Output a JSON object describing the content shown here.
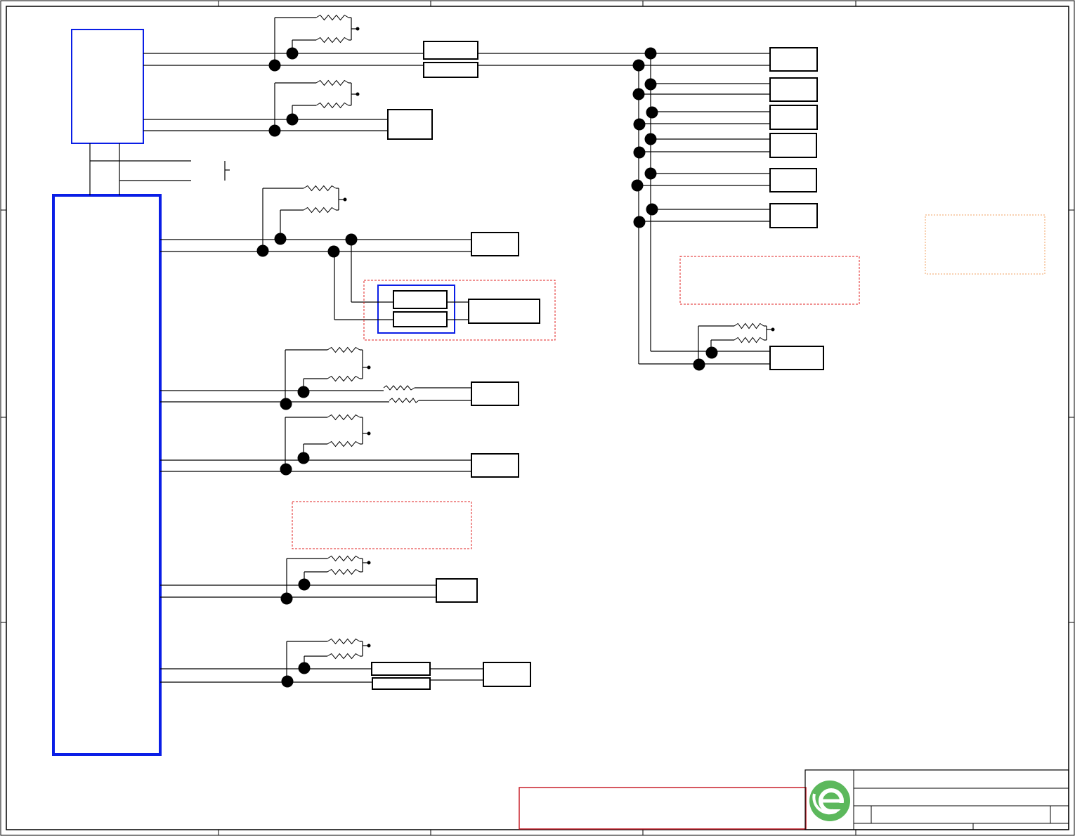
{
  "drawing": {
    "border_color": "#000000",
    "block_color": "#0a1ee6",
    "note_color": "#e02020",
    "logo_color": "#5cb85c"
  },
  "title_block": {
    "logo_icon": "company-logo-icon"
  }
}
